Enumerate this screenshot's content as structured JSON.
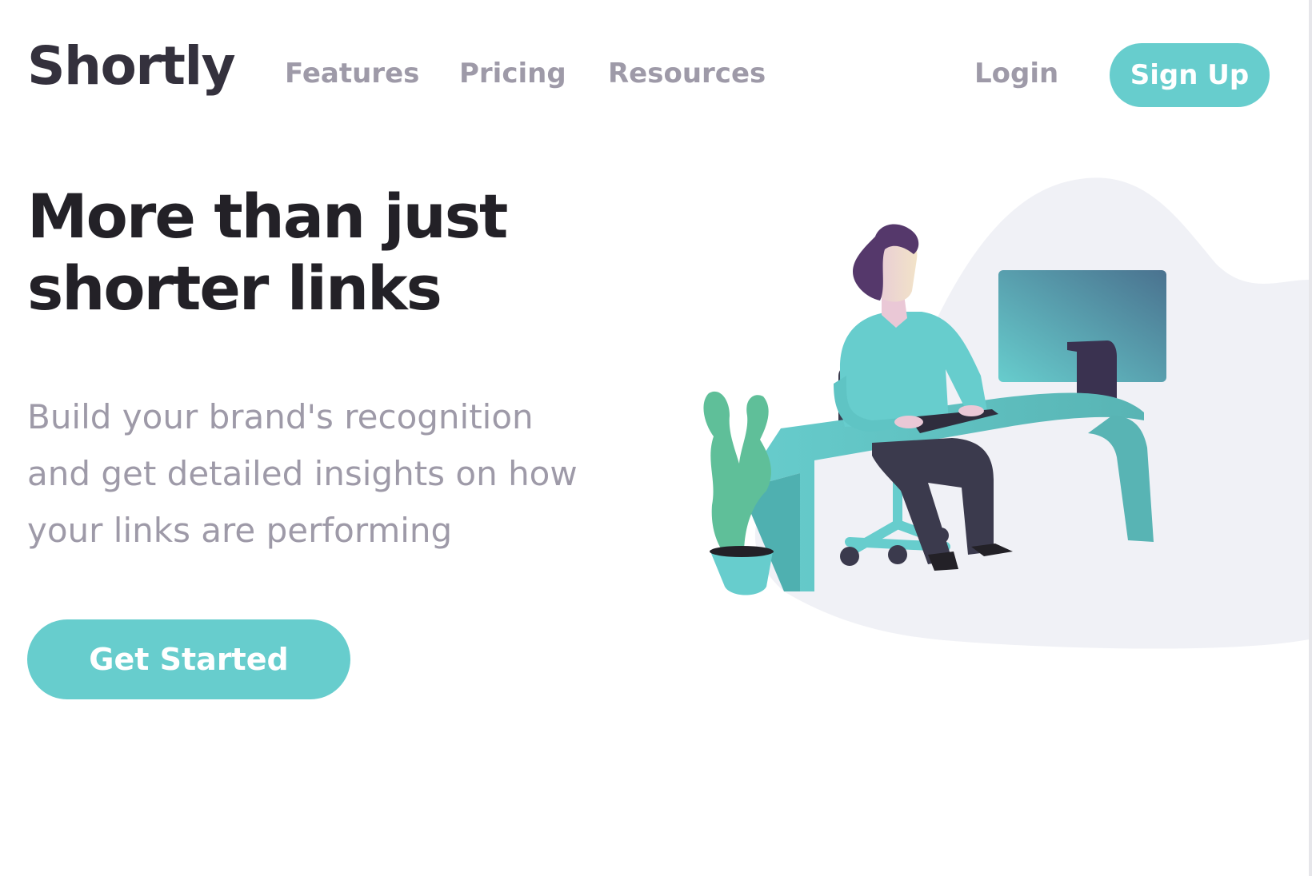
{
  "header": {
    "logo": "Shortly",
    "nav": [
      {
        "label": "Features"
      },
      {
        "label": "Pricing"
      },
      {
        "label": "Resources"
      }
    ],
    "login_label": "Login",
    "signup_label": "Sign Up"
  },
  "hero": {
    "title_line1": "More than just",
    "title_line2": "shorter links",
    "subtitle_line1": "Build your brand's recognition",
    "subtitle_line2": "and get detailed insights on how",
    "subtitle_line3": "your links are performing",
    "cta_label": "Get Started"
  },
  "colors": {
    "accent": "#67cdcd",
    "heading": "#232127",
    "muted": "#9e9aa8",
    "blob": "#f0f1f6"
  },
  "illustration": {
    "icon": "person-working-illustration"
  }
}
